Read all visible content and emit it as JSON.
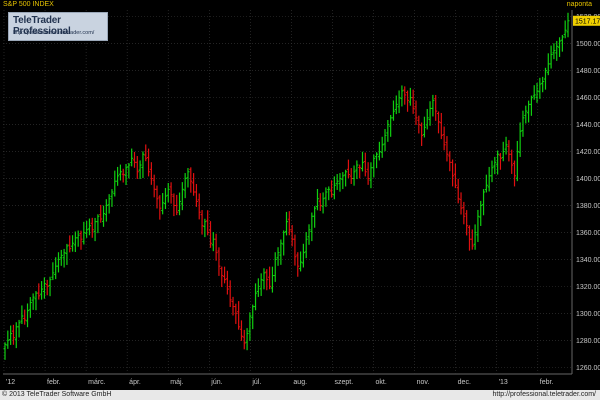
{
  "header": {
    "instrument_title": "S&P 500 INDEX",
    "interval_label": "naponta"
  },
  "logo": {
    "title": "TeleTrader Professional",
    "url": "http://professional.teletrader.com/"
  },
  "footer": {
    "copyright": "© 2013 TeleTrader Software GmbH",
    "url": "http://professional.teletrader.com/"
  },
  "colors": {
    "background": "#000000",
    "up_candle": "#10d010",
    "down_candle": "#e01010",
    "axis_text": "#c8c8c8",
    "grid": "#3a3a3a",
    "last_price_box": "#f0d000",
    "header_text": "#e8c400"
  },
  "chart_data": {
    "type": "bar",
    "style": "ohlc-bars",
    "interval": "daily",
    "last_price_label": "1517.17",
    "grid": true,
    "ylim": [
      1255,
      1525
    ],
    "y_ticks": [
      "1260.00",
      "1280.00",
      "1300.00",
      "1320.00",
      "1340.00",
      "1360.00",
      "1380.00",
      "1400.00",
      "1420.00",
      "1440.00",
      "1460.00",
      "1480.00",
      "1500.00",
      "1520.00"
    ],
    "x_ticks": [
      "'12",
      "febr.",
      "márc.",
      "ápr.",
      "máj.",
      "jún.",
      "júl.",
      "aug.",
      "szept.",
      "okt.",
      "nov.",
      "dec.",
      "'13",
      "febr."
    ],
    "closes": [
      1277,
      1280,
      1285,
      1282,
      1290,
      1293,
      1298,
      1295,
      1302,
      1308,
      1312,
      1315,
      1313,
      1318,
      1322,
      1320,
      1325,
      1330,
      1335,
      1340,
      1343,
      1345,
      1350,
      1348,
      1352,
      1356,
      1358,
      1355,
      1360,
      1362,
      1365,
      1362,
      1368,
      1372,
      1370,
      1374,
      1380,
      1385,
      1390,
      1398,
      1402,
      1405,
      1403,
      1408,
      1410,
      1415,
      1412,
      1405,
      1410,
      1418,
      1415,
      1405,
      1400,
      1392,
      1385,
      1378,
      1382,
      1387,
      1392,
      1388,
      1380,
      1375,
      1383,
      1392,
      1400,
      1405,
      1398,
      1390,
      1383,
      1375,
      1365,
      1368,
      1360,
      1352,
      1355,
      1345,
      1335,
      1328,
      1325,
      1318,
      1310,
      1305,
      1300,
      1290,
      1283,
      1278,
      1285,
      1298,
      1305,
      1315,
      1320,
      1325,
      1330,
      1325,
      1320,
      1328,
      1340,
      1345,
      1352,
      1360,
      1368,
      1362,
      1355,
      1342,
      1335,
      1338,
      1345,
      1355,
      1362,
      1372,
      1378,
      1385,
      1380,
      1385,
      1390,
      1392,
      1388,
      1395,
      1398,
      1400,
      1402,
      1405,
      1403,
      1400,
      1405,
      1410,
      1408,
      1412,
      1405,
      1400,
      1408,
      1415,
      1418,
      1420,
      1425,
      1432,
      1440,
      1445,
      1450,
      1455,
      1460,
      1465,
      1462,
      1458,
      1460,
      1452,
      1445,
      1440,
      1432,
      1438,
      1445,
      1452,
      1458,
      1450,
      1442,
      1432,
      1425,
      1418,
      1412,
      1402,
      1395,
      1385,
      1378,
      1372,
      1365,
      1355,
      1350,
      1360,
      1372,
      1380,
      1390,
      1395,
      1402,
      1408,
      1412,
      1418,
      1415,
      1420,
      1425,
      1418,
      1410,
      1402,
      1420,
      1435,
      1445,
      1450,
      1455,
      1460,
      1462,
      1465,
      1470,
      1472,
      1480,
      1485,
      1492,
      1495,
      1498,
      1502,
      1505,
      1510,
      1517
    ]
  }
}
